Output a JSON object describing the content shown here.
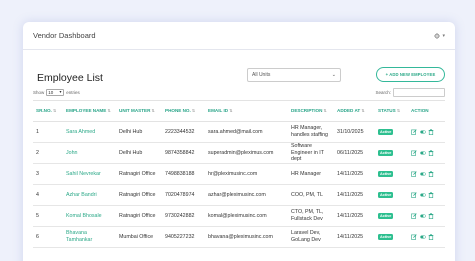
{
  "header": {
    "title": "Vendor Dashboard",
    "settings_icon": "gear-icon",
    "settings_caret": "▾"
  },
  "page": {
    "title": "Employee List",
    "unit_filter": "All Units",
    "add_button": "+ ADD NEW EMPLOYEE"
  },
  "controls": {
    "show_label": "Show",
    "entries_value": "10",
    "entries_label": "entries",
    "search_label": "Search:"
  },
  "table": {
    "columns": [
      "SR.NO.",
      "EMPLOYEE NAME",
      "UNIT MASTER",
      "PHONE NO.",
      "EMAIL ID",
      "DESCRIPTION",
      "ADDED AT",
      "STATUS",
      "ACTION"
    ],
    "rows": [
      {
        "sr": "1",
        "name": "Sara Ahmed",
        "unit": "Delhi Hub",
        "phone": "2223344532",
        "email": "sara.ahmed@mail.com",
        "desc": "HR Manager, handles staffing",
        "added": "31/10/2025",
        "status": "Active"
      },
      {
        "sr": "2",
        "name": "John",
        "unit": "Delhi Hub",
        "phone": "9874358842",
        "email": "superadmin@pleximus.com",
        "desc": "Software Engineer in IT dept",
        "added": "06/11/2025",
        "status": "Active"
      },
      {
        "sr": "3",
        "name": "Sahil Nevrekar",
        "unit": "Ratnagiri Office",
        "phone": "7498838188",
        "email": "hr@pleximusinc.com",
        "desc": "HR Manager",
        "added": "14/11/2025",
        "status": "Active"
      },
      {
        "sr": "4",
        "name": "Azhar Bandri",
        "unit": "Ratnagiri Office",
        "phone": "7020478974",
        "email": "azhar@pleximusinc.com",
        "desc": "COO, PM, TL",
        "added": "14/11/2025",
        "status": "Active"
      },
      {
        "sr": "5",
        "name": "Komal Bhosale",
        "unit": "Ratnagiri Office",
        "phone": "9730242882",
        "email": "komal@pleximusinc.com",
        "desc": "CTO, PM, TL, Fullstack Dev",
        "added": "14/11/2025",
        "status": "Active"
      },
      {
        "sr": "6",
        "name": "Bhavana Tamhankar",
        "unit": "Mumbai Office",
        "phone": "9405227232",
        "email": "bhavana@pleximusinc.com",
        "desc": "Laravel Dev, GoLang Dev",
        "added": "14/11/2025",
        "status": "Active"
      }
    ],
    "action_icons": [
      "edit-icon",
      "toggle-icon",
      "delete-icon"
    ]
  },
  "colors": {
    "accent": "#2aa887",
    "status_active": "#2dbf8f",
    "background": "#eef1fb"
  }
}
